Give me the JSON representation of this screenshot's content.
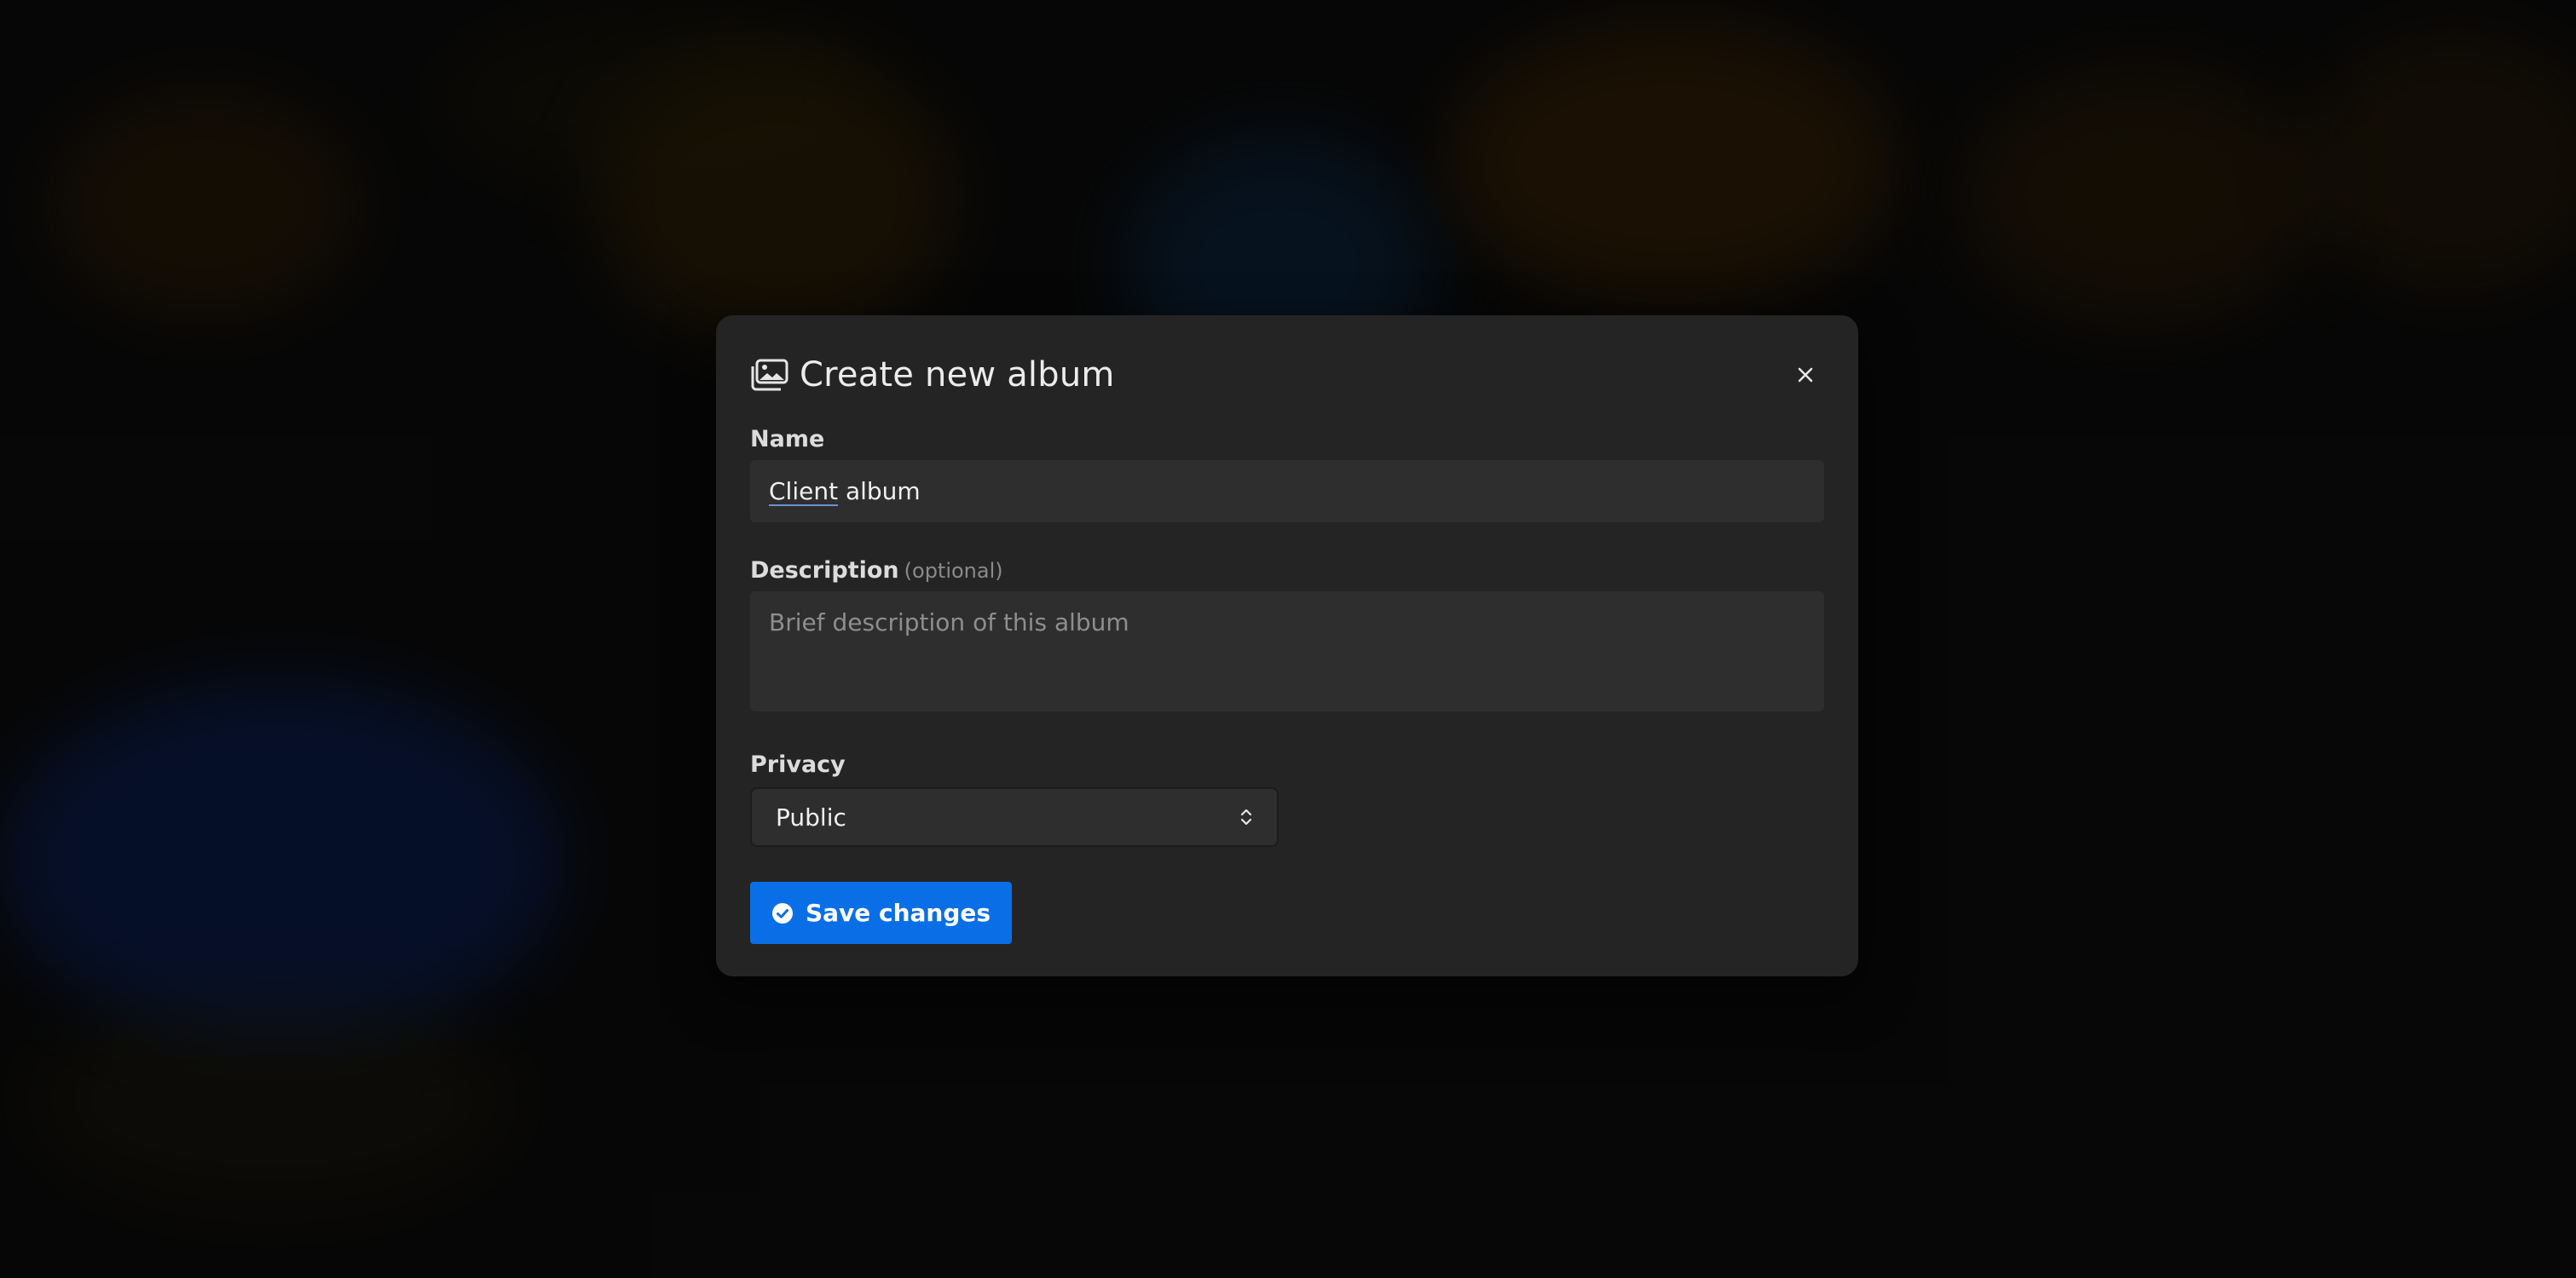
{
  "dialog": {
    "title": "Create new album",
    "title_icon": "photo-album-icon",
    "close_icon": "close-icon"
  },
  "form": {
    "name": {
      "label": "Name",
      "value_part1": "Client",
      "value_part2": " album"
    },
    "description": {
      "label": "Description",
      "optional": "(optional)",
      "placeholder": "Brief description of this album",
      "value": ""
    },
    "privacy": {
      "label": "Privacy",
      "selected": "Public",
      "icon": "chevron-up-down-icon"
    }
  },
  "actions": {
    "save_label": "Save changes",
    "save_icon": "check-circle-icon",
    "save_color": "#0a6fe6"
  },
  "colors": {
    "modal_bg": "#242424",
    "input_bg": "#2e2e2e"
  }
}
